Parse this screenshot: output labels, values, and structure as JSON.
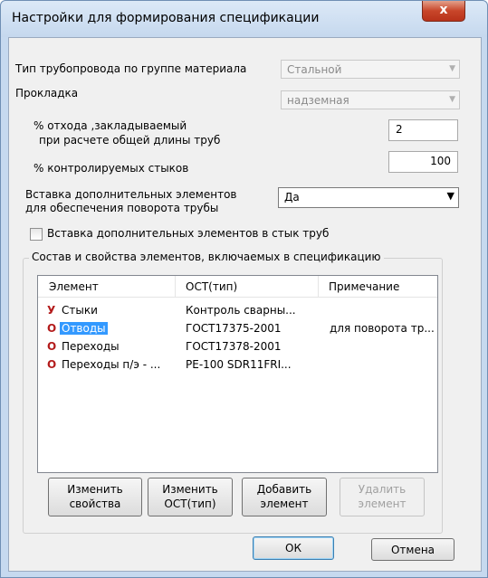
{
  "window": {
    "title": "Настройки для формирования спецификации",
    "close_glyph": "x"
  },
  "fields": {
    "pipe_type_label": "Тип трубопровода по группе материала",
    "pipe_type_value": "Стальной",
    "laying_label": "Прокладка",
    "laying_value": "надземная",
    "waste_label_1": "% отхода ,закладываемый",
    "waste_label_2": "при расчете общей длины труб",
    "waste_value": "2",
    "joints_label": "% контролируемых стыков",
    "joints_value": "100",
    "insert_label_1": "Вставка  дополнительных элементов",
    "insert_label_2": "для обеспечения поворота трубы",
    "insert_value": "Да",
    "checkbox_label": "Вставка  дополнительных элементов в стык труб"
  },
  "group": {
    "legend": "Состав и свойства  элементов, включаемых в  спецификацию",
    "columns": [
      "Элемент",
      "ОСТ(тип)",
      "Примечание"
    ],
    "rows": [
      {
        "icon": "У",
        "element": "Стыки",
        "ost": "Контроль сварны...",
        "note": ""
      },
      {
        "icon": "O",
        "element": "Отводы",
        "ost": "ГОСТ17375-2001",
        "note": "для  поворота тр..."
      },
      {
        "icon": "O",
        "element": "Переходы",
        "ost": "ГОСТ17378-2001",
        "note": ""
      },
      {
        "icon": "O",
        "element": "Переходы п/э - ...",
        "ost": "PE-100 SDR11FRI...",
        "note": ""
      }
    ]
  },
  "buttons": {
    "edit_props": [
      "Изменить",
      "свойства"
    ],
    "edit_ost": [
      "Изменить",
      "ОСТ(тип)"
    ],
    "add": [
      "Добавить",
      "элемент"
    ],
    "delete": [
      "Удалить",
      "элемент"
    ],
    "ok": "ОК",
    "cancel": "Отмена"
  },
  "colors": {
    "selection": "#3399ff",
    "icon": "#b31b1b",
    "frame": "#c6d9ef"
  }
}
